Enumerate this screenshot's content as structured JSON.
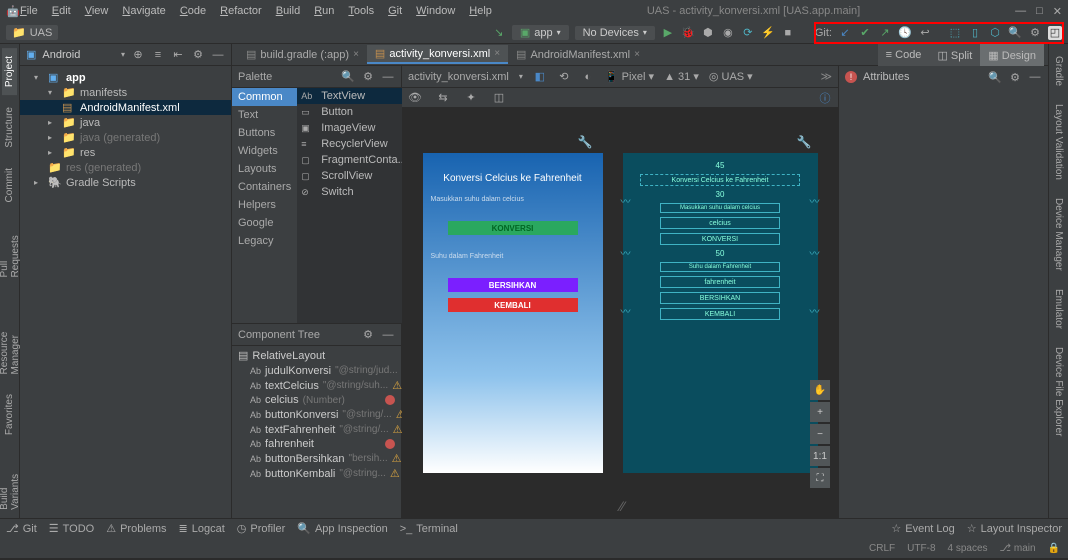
{
  "menu": [
    "File",
    "Edit",
    "View",
    "Navigate",
    "Code",
    "Refactor",
    "Build",
    "Run",
    "Tools",
    "Git",
    "Window",
    "Help"
  ],
  "window_title": "UAS - activity_konversi.xml [UAS.app.main]",
  "project_name": "UAS",
  "run_config": "app",
  "device_dd": "No Devices",
  "git_label": "Git:",
  "tabs": [
    {
      "name": "AndroidManifest.xml",
      "active": false
    },
    {
      "name": "activity_konversi.xml",
      "active": true
    },
    {
      "name": "build.gradle (:app)",
      "active": false
    }
  ],
  "left_rail": [
    "Project",
    "Structure",
    "Commit",
    "Pull Requests",
    "Resource Manager",
    "Favorites",
    "Build Variants"
  ],
  "tree_header": "Android",
  "tree": {
    "app": "app",
    "manifests": "manifests",
    "manifest_file": "AndroidManifest.xml",
    "java": "java",
    "java_gen": "java (generated)",
    "res": "res",
    "res_gen": "res (generated)",
    "gradle": "Gradle Scripts"
  },
  "palette": {
    "title": "Palette",
    "cats": [
      "Common",
      "Text",
      "Buttons",
      "Widgets",
      "Layouts",
      "Containers",
      "Helpers",
      "Google",
      "Legacy"
    ],
    "items": [
      "TextView",
      "Button",
      "ImageView",
      "RecyclerView",
      "FragmentConta...",
      "ScrollView",
      "Switch"
    ]
  },
  "component_tree": {
    "title": "Component Tree",
    "root": "RelativeLayout",
    "items": [
      {
        "n": "judulKonversi",
        "h": "\"@string/jud...",
        "w": true
      },
      {
        "n": "textCelcius",
        "h": "\"@string/suh...",
        "w": true
      },
      {
        "n": "celcius",
        "h": "(Number)",
        "e": true
      },
      {
        "n": "buttonKonversi",
        "h": "\"@string/...",
        "w": true
      },
      {
        "n": "textFahrenheit",
        "h": "\"@string/...",
        "w": true
      },
      {
        "n": "fahrenheit",
        "h": "",
        "e": true
      },
      {
        "n": "buttonBersihkan",
        "h": "\"bersih...",
        "w": true
      },
      {
        "n": "buttonKembali",
        "h": "\"@string...",
        "w": true
      }
    ]
  },
  "design_tb": {
    "file": "activity_konversi.xml",
    "device": "Pixel",
    "api": "31",
    "theme": "UAS"
  },
  "view_toggle": [
    "Code",
    "Split",
    "Design"
  ],
  "phone": {
    "title": "Konversi Celcius ke Fahrenheit",
    "hint1": "Masukkan suhu dalam celcius",
    "btn_konv": "KONVERSI",
    "hint2": "Suhu dalam Fahrenheit",
    "btn_ber": "BERSIHKAN",
    "btn_kem": "KEMBALI"
  },
  "blueprint": {
    "m1": "45",
    "m2": "30",
    "m3": "50",
    "title": "Konversi Celcius ke Fahrenheit",
    "hint1": "Masukkan suhu dalam celcius",
    "cel": "celcius",
    "konv": "KONVERSI",
    "hint2": "Suhu dalam Fahrenheit",
    "fah": "fahrenheit",
    "ber": "BERSIHKAN",
    "kem": "KEMBALI"
  },
  "attrs_title": "Attributes",
  "bottom": [
    "Git",
    "TODO",
    "Problems",
    "Logcat",
    "Profiler",
    "App Inspection",
    "Terminal"
  ],
  "bottom_right": [
    "Event Log",
    "Layout Inspector"
  ],
  "status": {
    "crlf": "CRLF",
    "enc": "UTF-8",
    "spaces": "4 spaces",
    "branch": "main"
  },
  "right_rail": [
    "Gradle",
    "Layout Validation",
    "Device Manager",
    "Emulator",
    "Device File Explorer"
  ],
  "canvas_btns": [
    "✋",
    "+",
    "−",
    "1:1",
    "⛶"
  ]
}
